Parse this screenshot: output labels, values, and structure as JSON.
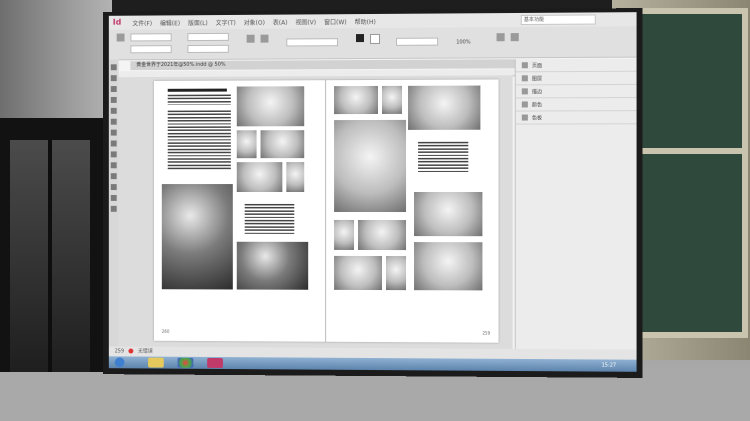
{
  "app": {
    "menu_items": [
      "文件(F)",
      "编辑(E)",
      "版面(L)",
      "文字(T)",
      "对象(O)",
      "表(A)",
      "视图(V)",
      "窗口(W)",
      "帮助(H)"
    ],
    "search_placeholder": "基本功能",
    "zoom_value": "100%",
    "document_tab": "黄金世界于2021年@50%.indd @ 50%",
    "page_number": "259",
    "status_text": "无错误",
    "clock": "15:27"
  },
  "panels": {
    "items": [
      {
        "label": "页面",
        "icon": "pages-icon"
      },
      {
        "label": "图层",
        "icon": "layers-icon"
      },
      {
        "label": "描边",
        "icon": "stroke-icon"
      },
      {
        "label": "颜色",
        "icon": "color-icon"
      },
      {
        "label": "色板",
        "icon": "swatches-icon"
      }
    ]
  },
  "spread": {
    "left_folio": "260",
    "right_folio": "259"
  },
  "colors": {
    "indesign_logo": "#c03a6a",
    "taskbar": "#5d84ad",
    "chalkboard": "#2f4a3c"
  }
}
